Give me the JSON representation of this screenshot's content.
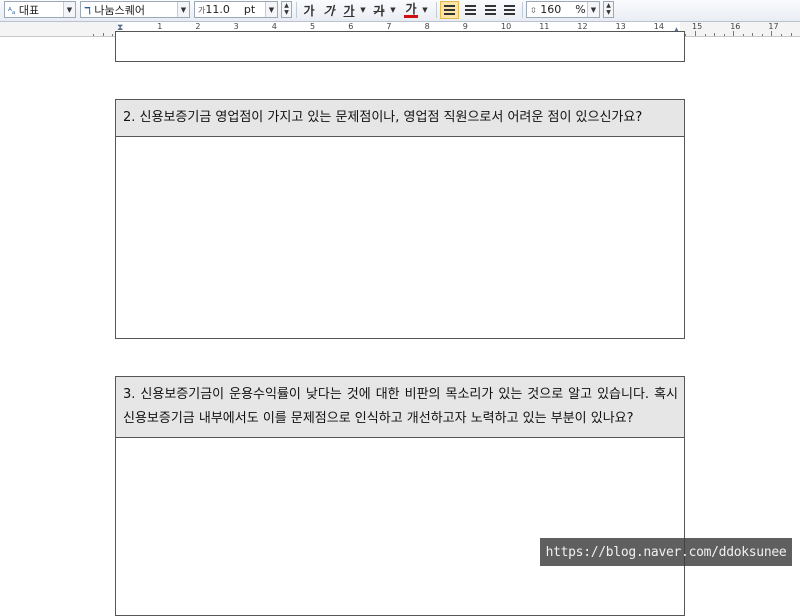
{
  "toolbar": {
    "style_value": "대표",
    "font_value": "나눔스퀘어",
    "size_value": "11.0",
    "size_unit": "pt",
    "bold_label": "가",
    "italic_label": "가",
    "underline_label": "가",
    "strike_label": "가",
    "color_label": "가",
    "line_spacing_value": "160",
    "line_spacing_unit": "%"
  },
  "ruler": {
    "numbers": [
      "1",
      "2",
      "3",
      "4",
      "5",
      "6",
      "7",
      "8",
      "9",
      "10",
      "11",
      "12",
      "13",
      "14",
      "15",
      "16",
      "17"
    ]
  },
  "questions": [
    {
      "text": "2. 신용보증기금 영업점이 가지고 있는 문제점이나, 영업점 직원으로서 어려운 점이 있으신가요?"
    },
    {
      "text": "3. 신용보증기금이 운용수익률이 낮다는 것에 대한 비판의 목소리가 있는 것으로 알고 있습니다. 혹시 신용보증기금 내부에서도 이를 문제점으로 인식하고 개선하고자 노력하고 있는 부분이 있나요?"
    }
  ],
  "watermark": "https://blog.naver.com/ddoksunee",
  "colors": {
    "header_bg": "#e6e6e6",
    "active_btn": "#fde5a8",
    "font_color_underline": "#d01010"
  }
}
